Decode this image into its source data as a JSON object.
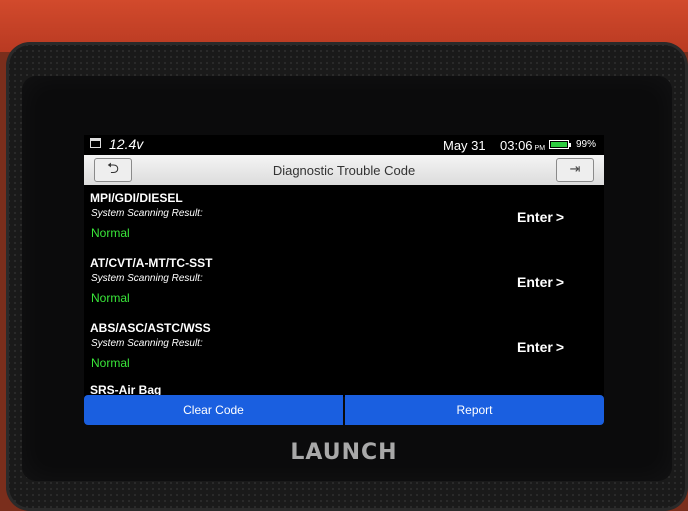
{
  "status_bar": {
    "voltage": "12.4v",
    "date": "May 31",
    "time": "03:06",
    "ampm": "PM",
    "battery_percent": "99%",
    "battery_level": 0.99
  },
  "header": {
    "title": "Diagnostic Trouble Code",
    "back_icon": "back-arrow-icon",
    "exit_icon": "exit-icon"
  },
  "systems": [
    {
      "name": "MPI/GDI/DIESEL",
      "result_label": "System Scanning Result:",
      "status": "Normal",
      "action": "Enter"
    },
    {
      "name": "AT/CVT/A-MT/TC-SST",
      "result_label": "System Scanning Result:",
      "status": "Normal",
      "action": "Enter"
    },
    {
      "name": "ABS/ASC/ASTC/WSS",
      "result_label": "System Scanning Result:",
      "status": "Normal",
      "action": "Enter"
    },
    {
      "name": "SRS-Air Bag"
    }
  ],
  "footer": {
    "clear_label": "Clear Code",
    "report_label": "Report"
  },
  "device": {
    "brand": "LAUNCH"
  },
  "colors": {
    "button_blue": "#1a5fe0",
    "status_green": "#39e639",
    "shell_orange": "#c9442a"
  }
}
